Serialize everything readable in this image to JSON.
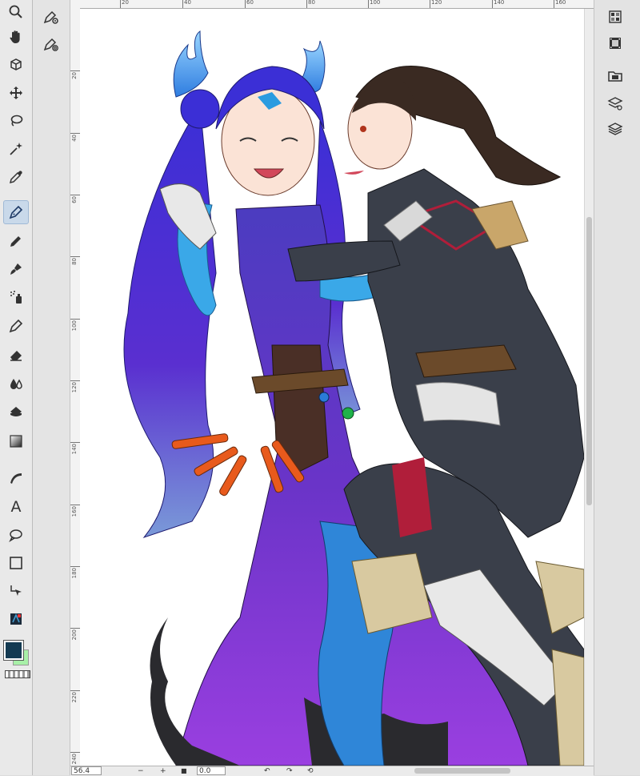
{
  "toolbar": {
    "tools": [
      {
        "name": "zoom-tool",
        "icon": "magnifier-icon"
      },
      {
        "name": "hand-tool",
        "icon": "hand-icon"
      },
      {
        "name": "rotate-tool",
        "icon": "cube-icon"
      },
      {
        "name": "move-tool",
        "icon": "move-arrows-icon"
      },
      {
        "name": "lasso-tool",
        "icon": "lasso-icon"
      },
      {
        "name": "auto-select-tool",
        "icon": "magic-wand-icon"
      },
      {
        "name": "eyedropper-tool",
        "icon": "eyedropper-icon"
      },
      {
        "name": "pen-tool",
        "icon": "pen-nib-icon",
        "active": true
      },
      {
        "name": "pencil-tool",
        "icon": "pencil-icon"
      },
      {
        "name": "brush-tool",
        "icon": "brush-icon"
      },
      {
        "name": "airbrush-tool",
        "icon": "airbrush-icon"
      },
      {
        "name": "decoration-tool",
        "icon": "decoration-pen-icon"
      },
      {
        "name": "eraser-tool",
        "icon": "eraser-icon"
      },
      {
        "name": "blend-tool",
        "icon": "droplets-icon"
      },
      {
        "name": "fill-tool",
        "icon": "bucket-icon"
      },
      {
        "name": "gradient-tool",
        "icon": "gradient-icon"
      },
      {
        "name": "figure-tool",
        "icon": "curve-icon"
      },
      {
        "name": "text-tool",
        "icon": "text-icon",
        "label": "A"
      },
      {
        "name": "balloon-tool",
        "icon": "speech-balloon-icon"
      },
      {
        "name": "frame-tool",
        "icon": "rectangle-icon"
      },
      {
        "name": "correct-line-tool",
        "icon": "object-arrow-icon"
      },
      {
        "name": "tool-property-tool",
        "icon": "app-icon"
      }
    ],
    "main_color": "#143a52",
    "sub_color": "#a8f0a8"
  },
  "subtool": {
    "items": [
      {
        "name": "pen-settings",
        "icon": "pen-gear-icon"
      },
      {
        "name": "pen-target",
        "icon": "pen-target-icon"
      }
    ]
  },
  "rulers": {
    "top_labels": [
      "20",
      "40",
      "60",
      "80",
      "100",
      "120",
      "140",
      "160"
    ],
    "left_labels": [
      "20",
      "40",
      "60",
      "80",
      "100",
      "120",
      "140",
      "160",
      "180",
      "200",
      "220",
      "240"
    ]
  },
  "bottombar": {
    "zoom": "56.4",
    "angle": "0.0",
    "zoom_out": "−",
    "zoom_in": "+",
    "fit": "■",
    "rotate_left": "↶",
    "rotate_right": "↷",
    "reset": "⟲"
  },
  "rightdock": {
    "items": [
      {
        "name": "navigator-panel-button",
        "icon": "navigator-icon"
      },
      {
        "name": "timeline-panel-button",
        "icon": "film-icon"
      },
      {
        "name": "material-panel-button",
        "icon": "folder-icon"
      },
      {
        "name": "layer-property-button",
        "icon": "layer-property-icon"
      },
      {
        "name": "layer-panel-button",
        "icon": "layers-icon"
      }
    ]
  },
  "colors": {
    "accent": "#c9d9ea",
    "hair_left": "#3d2fd8",
    "hair_right": "#3a2a22",
    "skin_blue": "#3aa8e8",
    "coat": "#3a3f4a",
    "trim": "#b01e3a",
    "dress_purple": "#8a3cd8"
  }
}
